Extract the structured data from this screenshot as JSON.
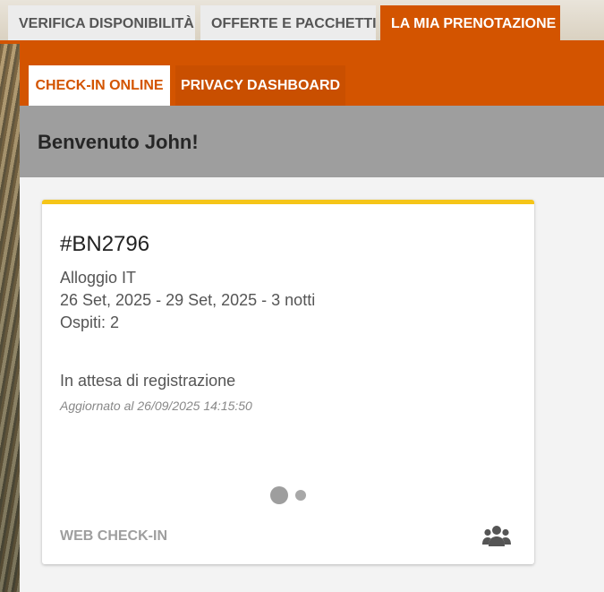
{
  "top_nav": {
    "tabs": [
      {
        "label": "VERIFICA DISPONIBILITÀ",
        "active": false
      },
      {
        "label": "OFFERTE E PACCHETTI",
        "active": false
      },
      {
        "label": "LA MIA PRENOTAZIONE",
        "active": true
      }
    ],
    "accent_color": "#d35400"
  },
  "sub_nav": {
    "tabs": [
      {
        "label": "CHECK-IN ONLINE",
        "active": true
      },
      {
        "label": "PRIVACY DASHBOARD",
        "active": false
      }
    ]
  },
  "welcome": {
    "title": "Benvenuto John!"
  },
  "booking_card": {
    "code": "#BN2796",
    "accommodation": "Alloggio IT",
    "dates": "26 Set, 2025 - 29 Set, 2025 - 3 notti",
    "guests": "Ospiti: 2",
    "status": "In attesa di registrazione",
    "updated": "Aggiornato al 26/09/2025 14:15:50",
    "action_label": "WEB CHECK-IN",
    "action_icon": "group-icon",
    "accent_color": "#f5c518"
  }
}
